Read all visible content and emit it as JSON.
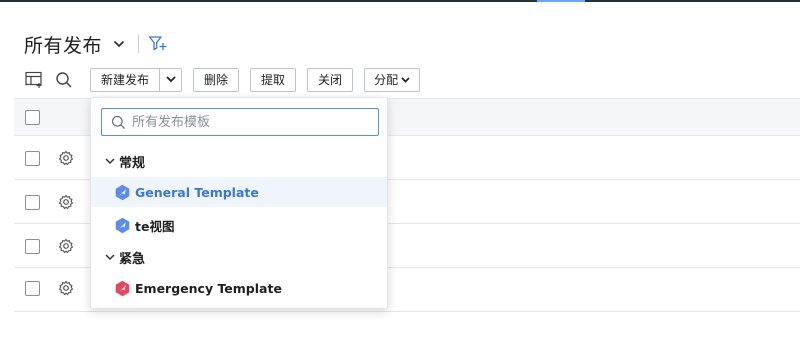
{
  "header": {
    "title": "所有发布"
  },
  "toolbar": {
    "new_release": "新建发布",
    "delete": "删除",
    "extract": "提取",
    "close": "关闭",
    "assign": "分配"
  },
  "table": {
    "row_count": 4
  },
  "template_menu": {
    "search_placeholder": "所有发布模板",
    "groups": [
      {
        "label": "常规",
        "items": [
          {
            "label": "General Template",
            "icon": "blue-template-icon",
            "active": true
          },
          {
            "label": "te视图",
            "icon": "blue-template-icon",
            "active": false
          }
        ]
      },
      {
        "label": "紧急",
        "items": [
          {
            "label": "Emergency Template",
            "icon": "red-template-icon",
            "active": false
          }
        ]
      }
    ]
  },
  "colors": {
    "accent": "#3b76d9",
    "normal_icon": "#5b8def",
    "emergency_icon": "#e8455f",
    "border_focus": "#5b8fd6"
  }
}
